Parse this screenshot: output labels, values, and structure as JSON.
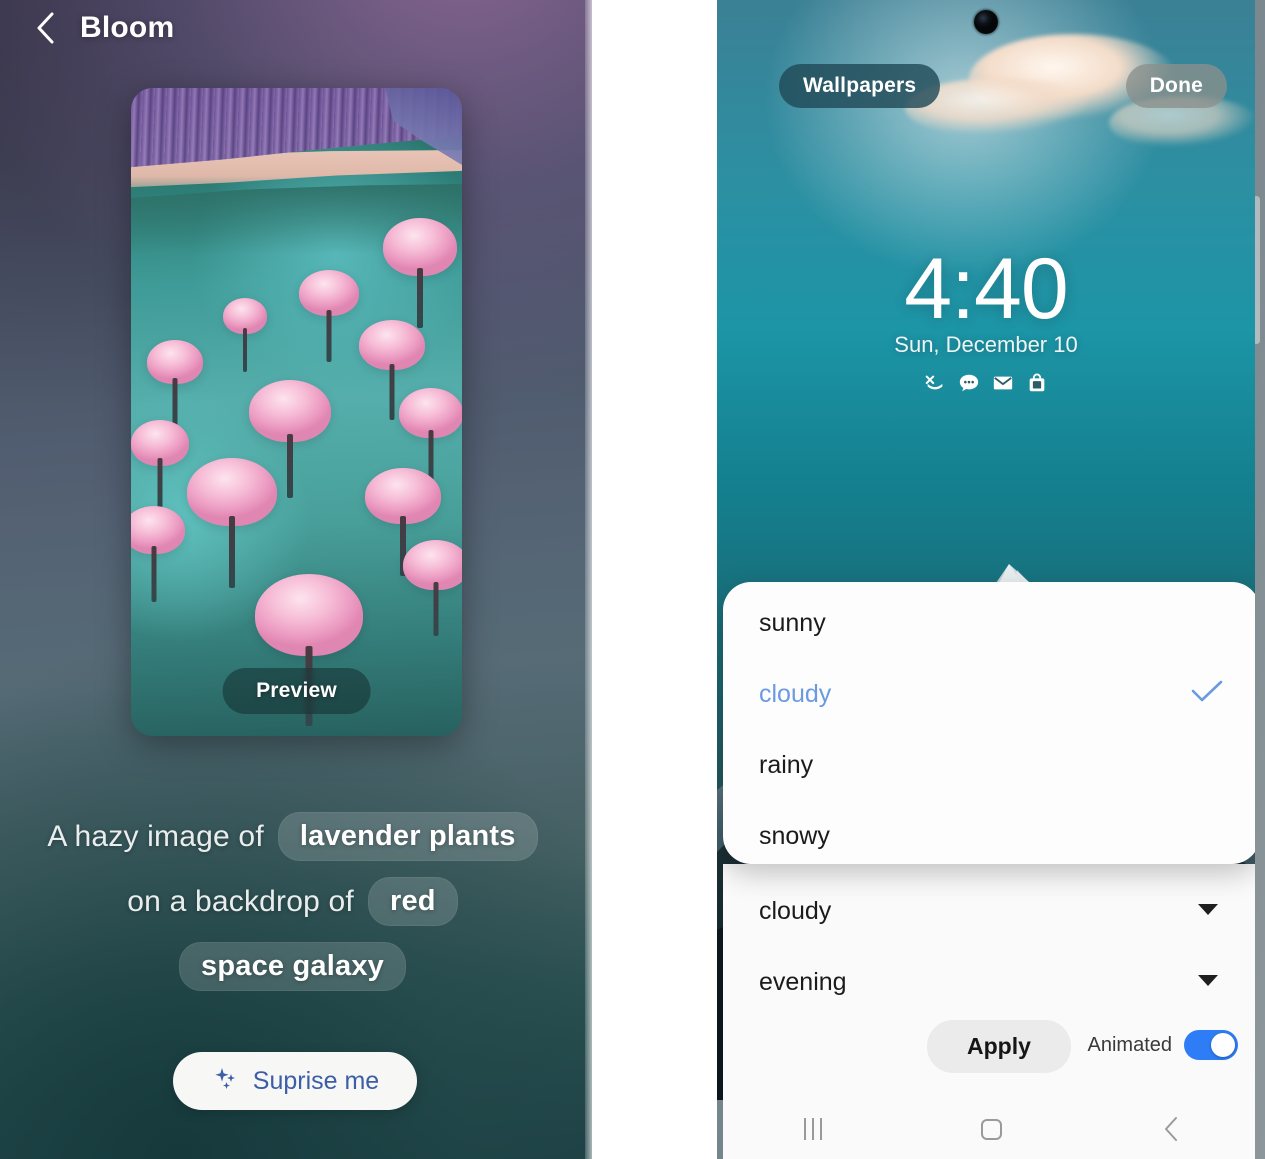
{
  "left_panel": {
    "header": {
      "back_icon": "chevron-left-icon",
      "title": "Bloom"
    },
    "preview": {
      "button_label": "Preview",
      "image_description": "cherry blossom trees in flooded teal water with purple forest shoreline"
    },
    "prompt": {
      "line1_prefix": "A hazy image of",
      "chip_subject": "lavender plants",
      "line2_prefix": "on a backdrop of",
      "chip_color": "red",
      "chip_scene": "space galaxy"
    },
    "surprise_button": {
      "label": "Suprise me",
      "icon": "sparkle-icon",
      "text_color": "#3c5ea8"
    }
  },
  "right_panel": {
    "overlay_buttons": {
      "wallpapers": "Wallpapers",
      "done": "Done"
    },
    "lock_screen": {
      "time": "4:40",
      "date": "Sun, December 10",
      "notification_icons": [
        "call-missed-icon",
        "message-bubble-icon",
        "envelope-icon",
        "shopping-bag-icon"
      ],
      "wallpaper_description": "snowy mountain peak under teal sky with cloud"
    },
    "dropdown": {
      "open": true,
      "options": [
        {
          "label": "sunny",
          "selected": false
        },
        {
          "label": "cloudy",
          "selected": true
        },
        {
          "label": "rainy",
          "selected": false
        },
        {
          "label": "snowy",
          "selected": false
        }
      ],
      "selected_color": "#6b9ae0",
      "check_icon": "check-icon"
    },
    "selectors": [
      {
        "name": "weather",
        "value": "cloudy",
        "icon": "caret-down-icon"
      },
      {
        "name": "time-of-day",
        "value": "evening",
        "icon": "caret-down-icon"
      }
    ],
    "apply_button": {
      "label": "Apply"
    },
    "animated_toggle": {
      "label": "Animated",
      "on": true,
      "accent": "#2e7df6"
    },
    "navbar": {
      "recents_icon": "recents-bars-icon",
      "home_icon": "home-square-icon",
      "back_icon": "chevron-left-icon"
    }
  }
}
